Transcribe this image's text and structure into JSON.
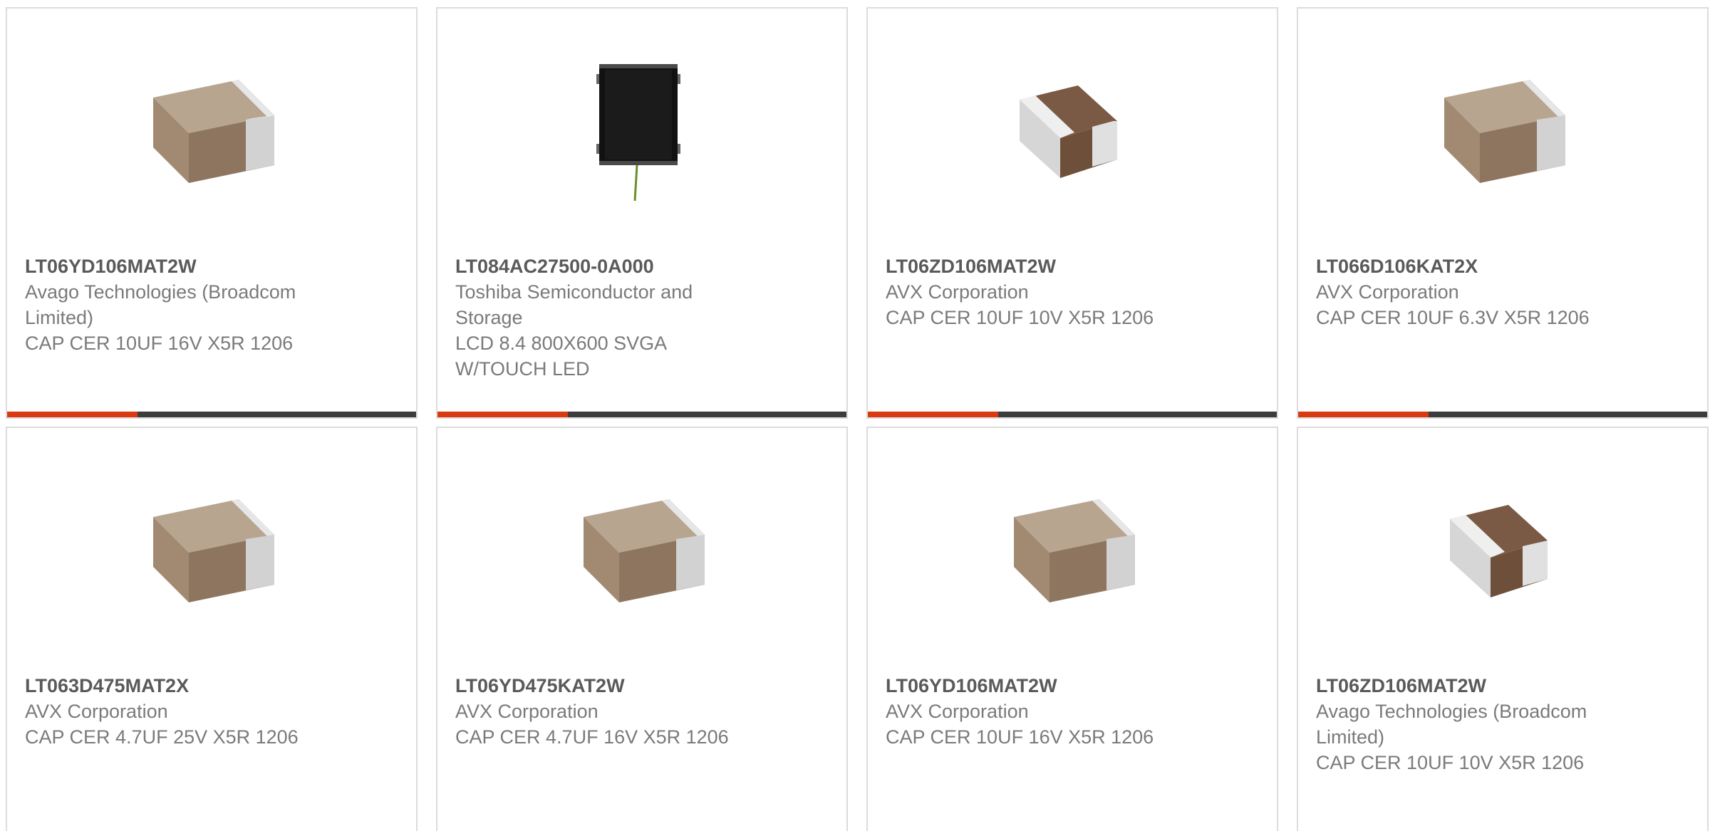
{
  "colors": {
    "accent_bar": "#d93a10",
    "dark_bar": "#3c3c3c",
    "part_text": "#5a5a5a",
    "body_text": "#7a7a7a",
    "card_border": "#dcdcdc"
  },
  "products": [
    {
      "part_number": "LT06YD106MAT2W",
      "manufacturer": "Avago Technologies (Broadcom Limited)",
      "description": "CAP CER 10UF 16V X5R 1206",
      "image": "ceramic-capacitor-tan"
    },
    {
      "part_number": "LT084AC27500-0A000",
      "manufacturer": "Toshiba Semiconductor and Storage",
      "description": "LCD 8.4 800X600 SVGA W/TOUCH LED",
      "image": "lcd-panel"
    },
    {
      "part_number": "LT06ZD106MAT2W",
      "manufacturer": "AVX Corporation",
      "description": "CAP CER 10UF 10V X5R 1206",
      "image": "ceramic-capacitor-brown"
    },
    {
      "part_number": "LT066D106KAT2X",
      "manufacturer": "AVX Corporation",
      "description": "CAP CER 10UF 6.3V X5R 1206",
      "image": "ceramic-capacitor-tan"
    },
    {
      "part_number": "LT063D475MAT2X",
      "manufacturer": "AVX Corporation",
      "description": "CAP CER 4.7UF 25V X5R 1206",
      "image": "ceramic-capacitor-tan"
    },
    {
      "part_number": "LT06YD475KAT2W",
      "manufacturer": "AVX Corporation",
      "description": "CAP CER 4.7UF 16V X5R 1206",
      "image": "ceramic-capacitor-tan"
    },
    {
      "part_number": "LT06YD106MAT2W",
      "manufacturer": "AVX Corporation",
      "description": "CAP CER 10UF 16V X5R 1206",
      "image": "ceramic-capacitor-tan"
    },
    {
      "part_number": "LT06ZD106MAT2W",
      "manufacturer": "Avago Technologies (Broadcom Limited)",
      "description": "CAP CER 10UF 10V X5R 1206",
      "image": "ceramic-capacitor-brown"
    }
  ]
}
